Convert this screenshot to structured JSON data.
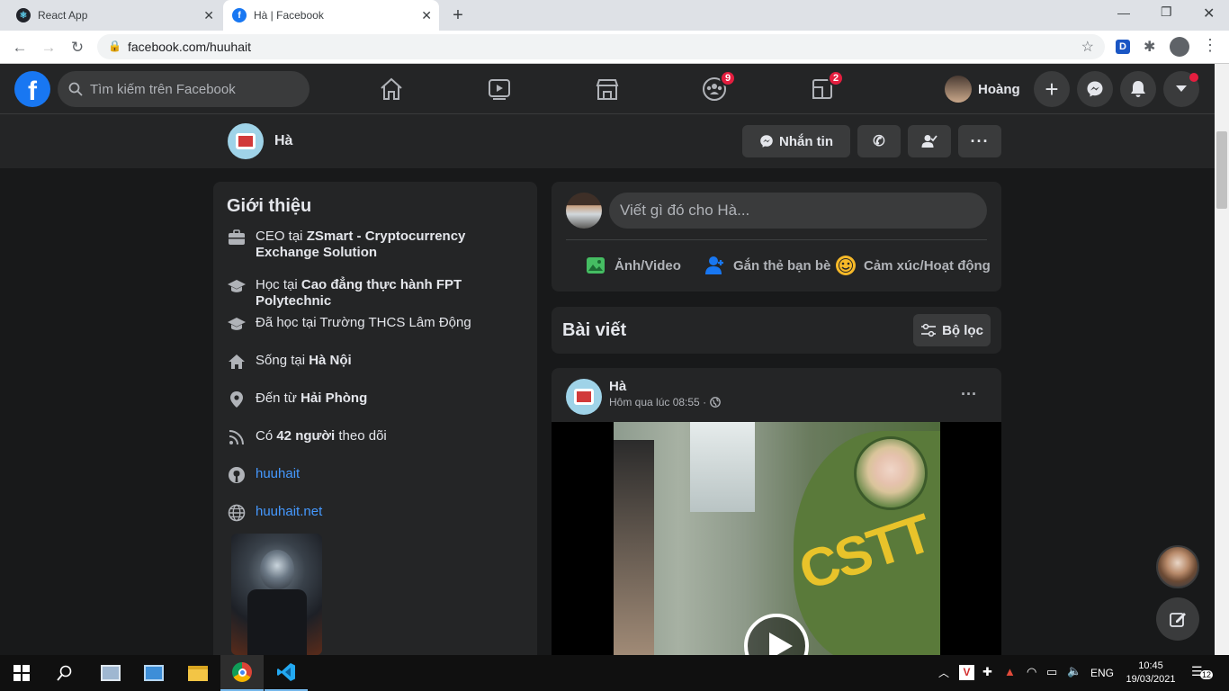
{
  "browser": {
    "tabs": [
      {
        "label": "React App",
        "active": false
      },
      {
        "label": "Hà | Facebook",
        "active": true
      }
    ],
    "url": "facebook.com/huuhait",
    "extension_letter": "D"
  },
  "header": {
    "search_placeholder": "Tìm kiếm trên Facebook",
    "groups_badge": "9",
    "gaming_badge": "2",
    "user_name": "Hoàng"
  },
  "profile": {
    "name": "Hà",
    "message_button": "Nhắn tin"
  },
  "intro": {
    "title": "Giới thiệu",
    "items": [
      {
        "icon": "briefcase-icon",
        "pre": "CEO tại ",
        "bold": "ZSmart - Cryptocurrency Exchange Solution",
        "post": ""
      },
      {
        "icon": "graduation-cap-icon",
        "pre": "Học tại ",
        "bold": "Cao đẳng thực hành FPT Polytechnic",
        "post": ""
      },
      {
        "icon": "graduation-cap-icon",
        "pre": "Đã học tại Trường THCS Lâm Động",
        "bold": "",
        "post": ""
      },
      {
        "icon": "home-icon",
        "pre": "Sống tại ",
        "bold": "Hà Nội",
        "post": ""
      },
      {
        "icon": "location-pin-icon",
        "pre": "Đến từ ",
        "bold": "Hải Phòng",
        "post": ""
      },
      {
        "icon": "rss-icon",
        "pre": "Có ",
        "bold": "42 người",
        "post": " theo dõi"
      }
    ],
    "github": "huuhait",
    "website": "huuhait.net"
  },
  "composer": {
    "placeholder": "Viết gì đó cho Hà...",
    "photo_video": "Ảnh/Video",
    "tag_friends": "Gắn thẻ bạn bè",
    "feeling": "Cảm xúc/Hoạt động"
  },
  "posts_header": {
    "title": "Bài viết",
    "filter": "Bộ lọc"
  },
  "post": {
    "author": "Hà",
    "time": "Hôm qua lúc 08:55 ·",
    "video_overlay_text": "CSTT"
  },
  "taskbar": {
    "lang": "ENG",
    "time": "10:45",
    "date": "19/03/2021",
    "notifications": "12"
  },
  "colors": {
    "fb_blue": "#1877f2",
    "link_blue": "#4599ff",
    "bg": "#18191a",
    "card": "#242526",
    "badge_red": "#e41e3f"
  }
}
